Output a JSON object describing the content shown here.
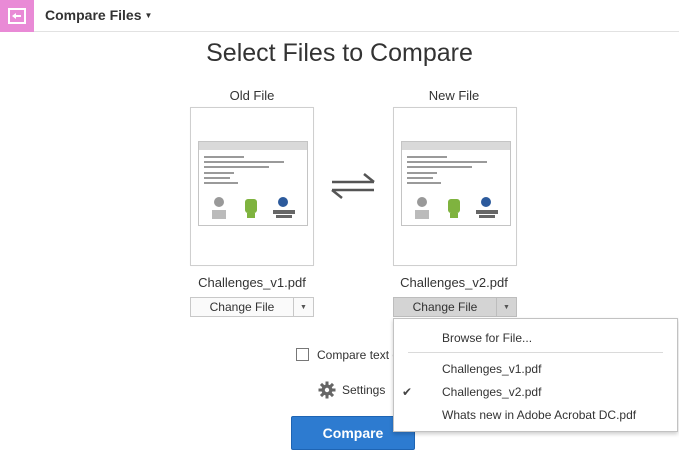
{
  "toolbar": {
    "title": "Compare Files",
    "icon": "compare-files-icon",
    "icon_color": "#e98ad6"
  },
  "main": {
    "heading": "Select Files to Compare",
    "old_file": {
      "label": "Old File",
      "filename": "Challenges_v1.pdf",
      "change_label": "Change File"
    },
    "new_file": {
      "label": "New File",
      "filename": "Challenges_v2.pdf",
      "change_label": "Change File"
    },
    "compare_text_label": "Compare text o",
    "compare_text_checked": false,
    "settings_label": "Settings",
    "compare_button": "Compare",
    "accent_color": "#2d7bd0"
  },
  "menu": {
    "browse": "Browse for File...",
    "recent": [
      {
        "label": "Challenges_v1.pdf",
        "checked": false
      },
      {
        "label": "Challenges_v2.pdf",
        "checked": true
      },
      {
        "label": "Whats new in Adobe Acrobat DC.pdf",
        "checked": false
      }
    ],
    "check_glyph": "✔"
  }
}
